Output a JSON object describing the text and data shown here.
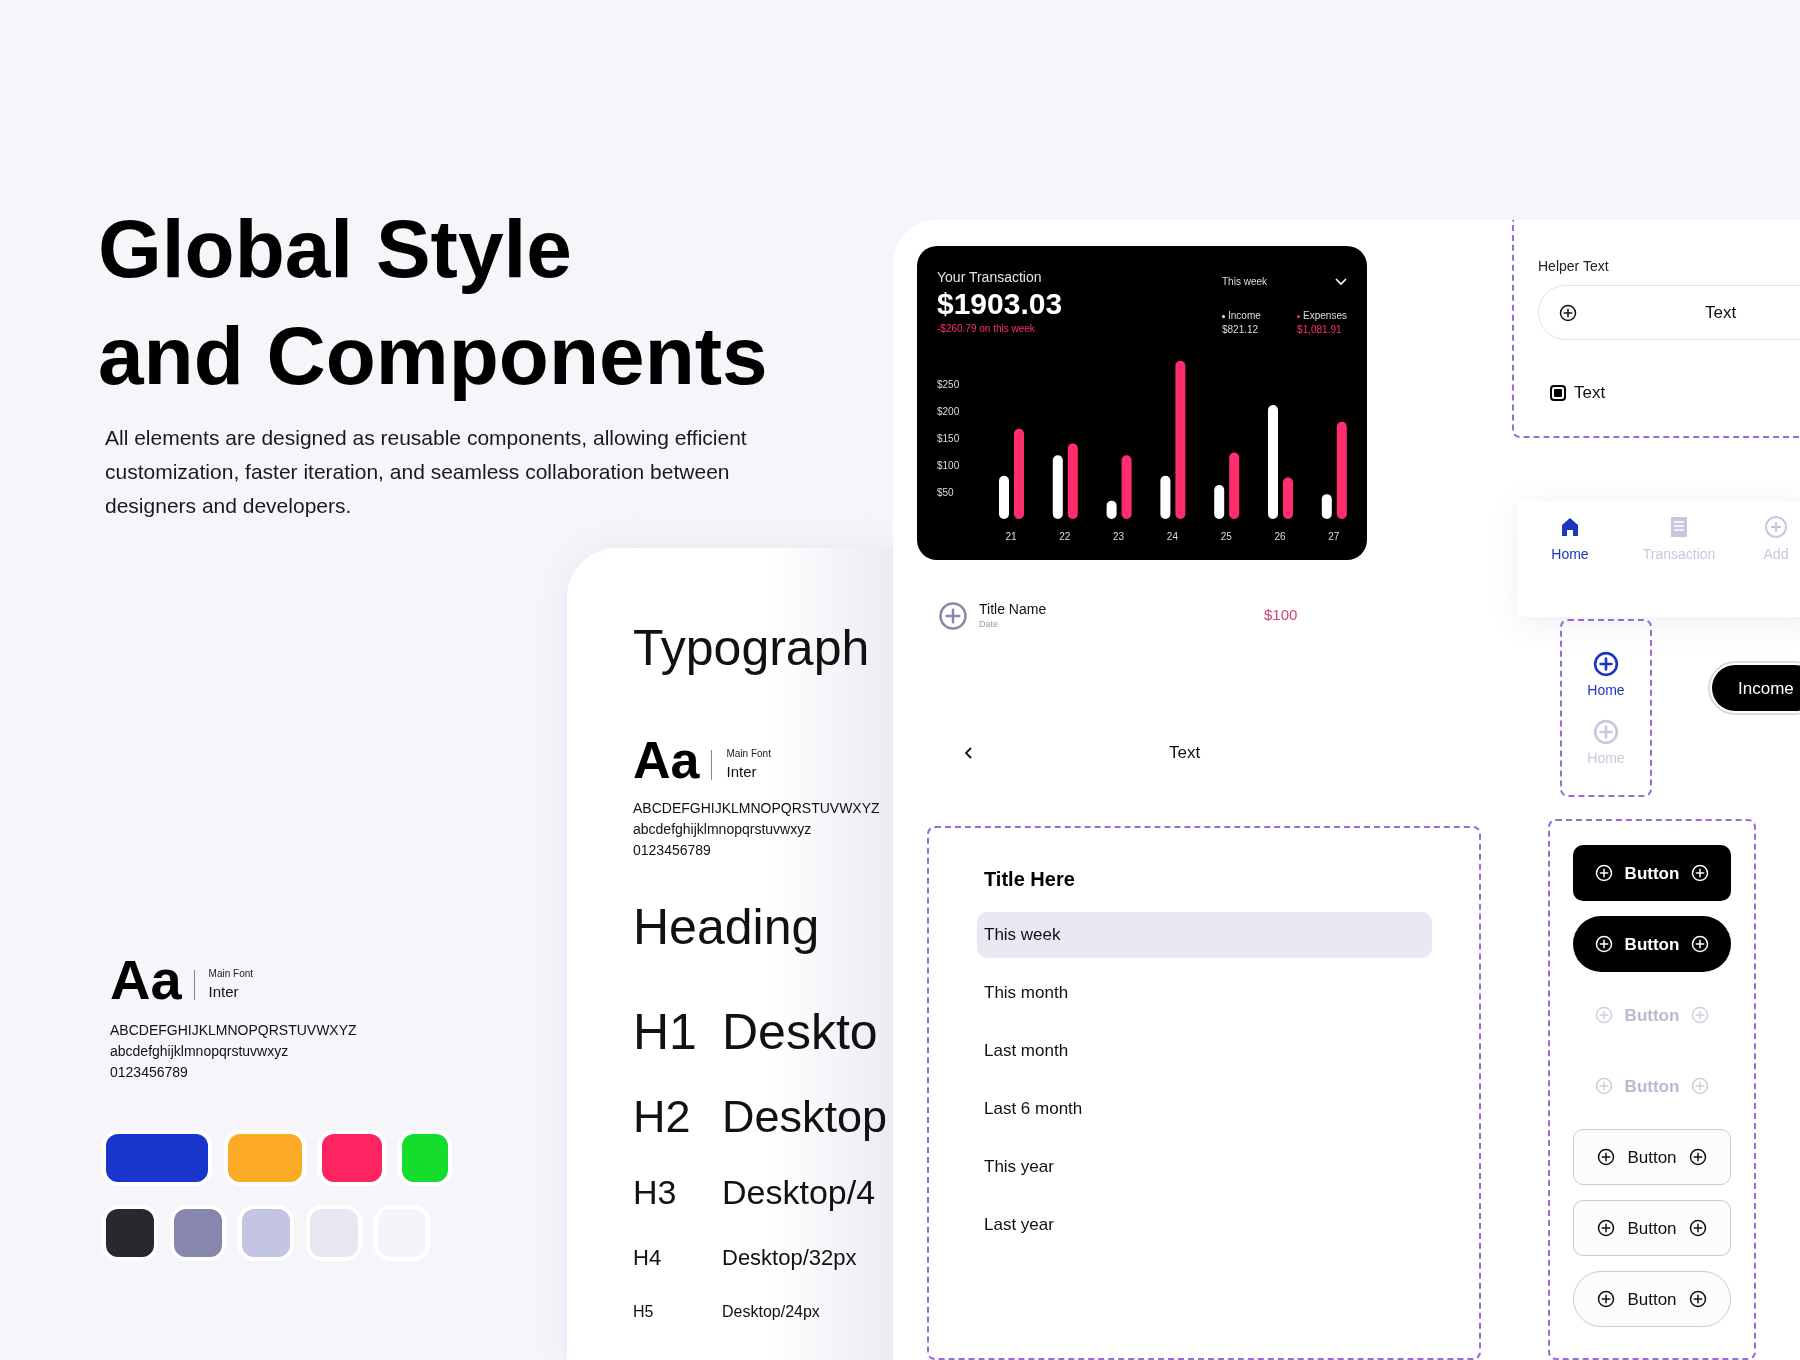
{
  "hero": {
    "title_lines": [
      "Global Style",
      "and Components"
    ],
    "description": "All elements are designed as reusable components, allowing efficient customization, faster iteration, and seamless collaboration between designers and developers."
  },
  "font_sample": {
    "glyph": "Aa",
    "caption": "Main Font",
    "font_name": "Inter",
    "alphabet_lines": [
      "ABCDEFGHIJKLMNOPQRSTUVWXYZ",
      "abcdefghijklmnopqrstuvwxyz",
      "0123456789"
    ]
  },
  "palette_rows": [
    {
      "swatches": [
        {
          "color": "#1836cc"
        },
        {
          "color": "#fdab27"
        },
        {
          "color": "#fd2461"
        },
        {
          "color": "#14dd2e"
        }
      ]
    },
    {
      "swatches": [
        {
          "color": "#28292d"
        },
        {
          "color": "#8787ad"
        },
        {
          "color": "#c3c5e3"
        },
        {
          "color": "#e7e7f2"
        },
        {
          "color": "#f5f5f9"
        }
      ]
    }
  ],
  "typography_card": {
    "title": "Typograph",
    "font_sample": {
      "glyph": "Aa",
      "caption": "Main Font",
      "font_name": "Inter",
      "alphabet_lines": [
        "ABCDEFGHIJKLMNOPQRSTUVWXYZ",
        "abcdefghijklmnopqrstuvwxyz",
        "0123456789"
      ]
    },
    "heading": "Heading",
    "styles": [
      {
        "tag": "H1",
        "sample": "Deskto"
      },
      {
        "tag": "H2",
        "sample": "Desktop"
      },
      {
        "tag": "H3",
        "sample": "Desktop/4"
      },
      {
        "tag": "H4",
        "sample": "Desktop/32px"
      },
      {
        "tag": "H5",
        "sample": "Desktop/24px"
      }
    ]
  },
  "transaction_card": {
    "title": "Your Transaction",
    "total": "$1903.03",
    "change": "-$260.79 on this week",
    "period": "This week",
    "series_totals": [
      "$821.12",
      "$1,081.91"
    ],
    "chart_data": {
      "type": "bar",
      "categories": [
        "21",
        "22",
        "23",
        "24",
        "25",
        "26",
        "27"
      ],
      "series": [
        {
          "name": "Income",
          "color": "#ffffff",
          "values": [
            80,
            118,
            34,
            80,
            63,
            211,
            46
          ]
        },
        {
          "name": "Expenses",
          "color": "#ff2d6b",
          "values": [
            167,
            140,
            118,
            293,
            123,
            77,
            180
          ]
        }
      ],
      "ylim": [
        0,
        300
      ],
      "yticks": [
        {
          "value": 50,
          "label": "$50"
        },
        {
          "value": 100,
          "label": "$100"
        },
        {
          "value": 150,
          "label": "$150"
        },
        {
          "value": 200,
          "label": "$200"
        },
        {
          "value": 250,
          "label": "$250"
        }
      ]
    }
  },
  "list_item": {
    "title": "Title Name",
    "subtitle": "Date",
    "amount": "$100"
  },
  "header_bar": {
    "title": "Text"
  },
  "dropdown": {
    "title": "Title Here",
    "options": [
      {
        "label": "This week",
        "selected": true
      },
      {
        "label": "This month",
        "selected": false
      },
      {
        "label": "Last month",
        "selected": false
      },
      {
        "label": "Last 6 month",
        "selected": false
      },
      {
        "label": "This year",
        "selected": false
      },
      {
        "label": "Last year",
        "selected": false
      }
    ]
  },
  "input_group": {
    "helper_text": "Helper Text",
    "input_value": "Text",
    "checkbox": {
      "label": "Text",
      "checked": true
    }
  },
  "bottom_nav": [
    {
      "label": "Home",
      "kind": "home",
      "selected": true
    },
    {
      "label": "Transaction",
      "kind": "receipt",
      "selected": false
    },
    {
      "label": "Add",
      "kind": "add",
      "selected": false
    }
  ],
  "side_tabs": [
    {
      "label": "Home",
      "selected": true
    },
    {
      "label": "Home",
      "selected": false
    }
  ],
  "chip": {
    "label": "Income",
    "selected": true
  },
  "buttons": [
    {
      "label": "Button",
      "kind": "filled",
      "pill": false,
      "disabled": false
    },
    {
      "label": "Button",
      "kind": "filled",
      "pill": true,
      "disabled": false
    },
    {
      "label": "Button",
      "kind": "ghost",
      "pill": false,
      "disabled": true
    },
    {
      "label": "Button",
      "kind": "ghost",
      "pill": false,
      "disabled": true
    },
    {
      "label": "Button",
      "kind": "outline",
      "pill": false,
      "disabled": false
    },
    {
      "label": "Button",
      "kind": "outline",
      "pill": false,
      "disabled": false
    },
    {
      "label": "Button",
      "kind": "outline",
      "pill": true,
      "disabled": false
    }
  ]
}
